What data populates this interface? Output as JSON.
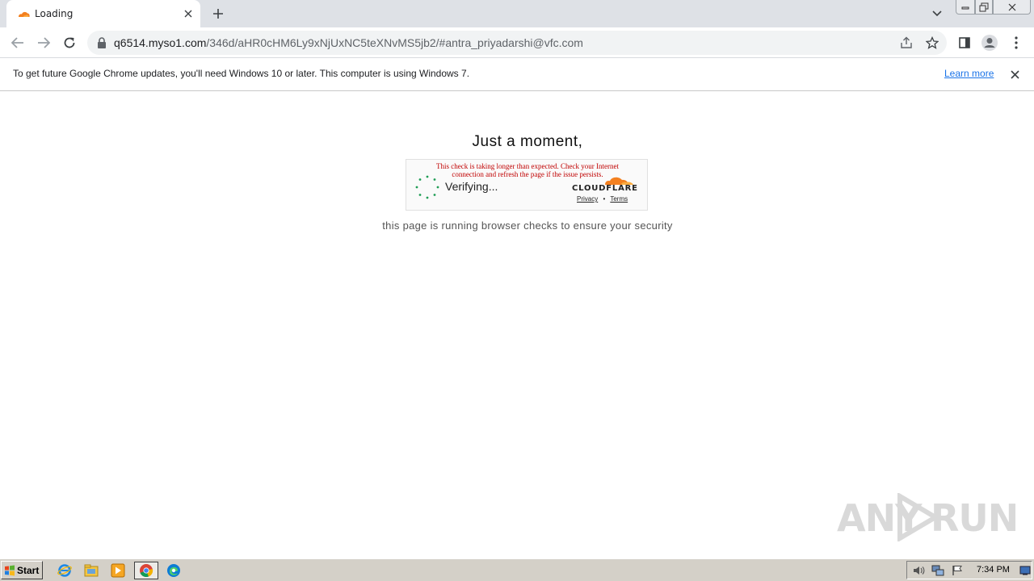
{
  "browser": {
    "tab": {
      "title": "Loading"
    },
    "address": {
      "host": "q6514.myso1.com",
      "path": "/346d/aHR0cHM6Ly9xNjUxNC5teXNvMS5jb2/#antra_priyadarshi@vfc.com"
    },
    "infobar": {
      "message": "To get future Google Chrome updates, you'll need Windows 10 or later. This computer is using Windows 7.",
      "link": "Learn more"
    }
  },
  "page": {
    "heading": "Just a moment,",
    "widget": {
      "warning_line1": "This check is taking longer than expected. Check your Internet",
      "warning_line2": "connection and refresh the page if the issue persists.",
      "status": "Verifying...",
      "brand": "CLOUDFLARE",
      "privacy": "Privacy",
      "separator": "•",
      "terms": "Terms"
    },
    "subtitle": "this page is running browser checks to ensure your security"
  },
  "watermark": {
    "left": "ANY",
    "right": "RUN"
  },
  "taskbar": {
    "start_label": "Start",
    "clock": "7:34 PM",
    "apps": [
      "ie-icon",
      "explorer-icon",
      "media-player-icon",
      "chrome-icon",
      "edge-icon"
    ]
  },
  "colors": {
    "warning_red": "#c00000",
    "cloudflare_orange": "#f38020",
    "link_blue": "#1a73e8",
    "spinner_green": "#1f9d55"
  }
}
